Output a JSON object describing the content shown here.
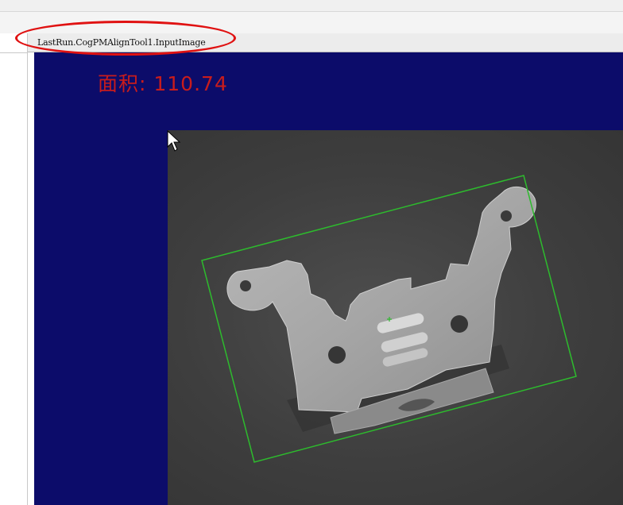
{
  "canvas": {
    "title": "LastRun.CogPMAlignTool1.InputImage"
  },
  "result": {
    "area_text": "面积: 110.74"
  },
  "colors": {
    "display_background": "#0c0c6a",
    "result_text": "#c81c1c",
    "annotation_circle": "#e01212",
    "match_box": "#2dbb2d"
  },
  "icons": {
    "cursor": "mouse-pointer-icon"
  }
}
